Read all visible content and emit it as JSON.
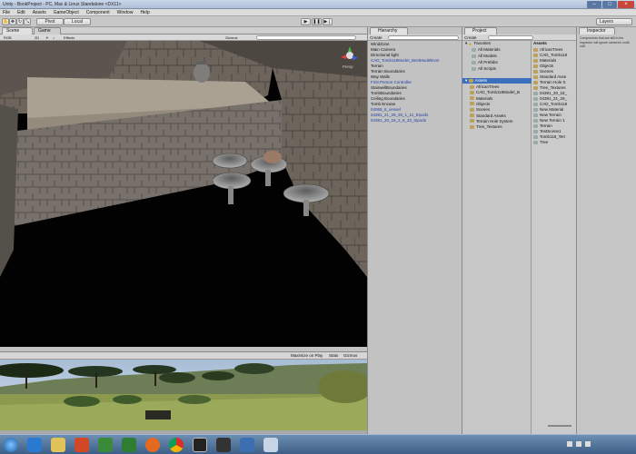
{
  "window": {
    "title": "Unity - BookProject - PC, Mac & Linux Standalone <DX11>",
    "menu": [
      "File",
      "Edit",
      "Assets",
      "GameObject",
      "Component",
      "Window",
      "Help"
    ]
  },
  "toolbar": {
    "pivot": "Pivot",
    "local": "Local",
    "layers": "Layers"
  },
  "scene_view": {
    "tabs": [
      "Scene",
      "Game"
    ],
    "shading": "RGB",
    "dim": "2D",
    "effects": "Effects",
    "gizmos": "Gizmos",
    "persp": "Persp"
  },
  "game_view": {
    "maximize_on_play": "Maximize on Play",
    "stats": "Stats",
    "gizmos": "Gizmos"
  },
  "hierarchy": {
    "tab": "Hierarchy",
    "create": "Create",
    "items": [
      {
        "label": "WindZone",
        "blue": false
      },
      {
        "label": "Main Camera",
        "blue": false
      },
      {
        "label": "Directional light",
        "blue": false
      },
      {
        "label": "CAD_Tomb118Model_BestModelEver",
        "blue": true
      },
      {
        "label": "Terrain",
        "blue": false
      },
      {
        "label": "Terrain Boundaries",
        "blue": false
      },
      {
        "label": "Way Walls",
        "blue": false
      },
      {
        "label": "First Person Controller",
        "blue": true
      },
      {
        "label": "StairwellBoundaries",
        "blue": false
      },
      {
        "label": "TombBoundaries",
        "blue": false
      },
      {
        "label": "Ceiling Boundaries",
        "blue": false
      },
      {
        "label": "Tomb Encase",
        "blue": false
      },
      {
        "label": "04065_6_vessel",
        "blue": true
      },
      {
        "label": "04391_21_29_30_1_11_tripods",
        "blue": true
      },
      {
        "label": "04391_20_18_2_6_22_tripods",
        "blue": true
      }
    ]
  },
  "project": {
    "tab": "Project",
    "create": "Create",
    "favorites": {
      "label": "Favorites",
      "items": [
        "All Materials",
        "All Models",
        "All Prefabs",
        "All Scripts"
      ]
    },
    "assets_tree": {
      "label": "Assets",
      "items": [
        "AfricanTrees",
        "CAD_Tomb118Model_B",
        "Materials",
        "Objects",
        "Scenes",
        "Standard Assets",
        "Terrain Hole System",
        "Tree_Textures"
      ]
    },
    "assets_header": "Assets",
    "assets_list": [
      "AfricanTrees",
      "CAD_Tomb118",
      "Materials",
      "Objects",
      "Scenes",
      "Standard Asse",
      "Terrain Hole S",
      "Tree_Textures",
      "04391_20_18_",
      "04391_21_29_",
      "CAD_Tomb118",
      "New Material",
      "New Terrain",
      "New Terrain 1",
      "Terrain",
      "TestScene1",
      "Tomb118_Terr",
      "Tree"
    ]
  },
  "inspector": {
    "tab": "Inspector",
    "text": "Components that are still in the Inspector will ignore camera's multi-edit."
  },
  "colors": {
    "accent": "#3d6fbf",
    "hierarchy_blue": "#1f3ea8",
    "panel_bg": "#c2c2c2"
  },
  "taskbar": {
    "icons": [
      "start-orb-icon",
      "ie-icon",
      "explorer-icon",
      "powerpoint-icon",
      "dreamweaver-icon",
      "excel-icon",
      "firefox-icon",
      "chrome-icon",
      "unity-icon",
      "unity-player-icon",
      "blender-icon",
      "photos-icon"
    ]
  }
}
